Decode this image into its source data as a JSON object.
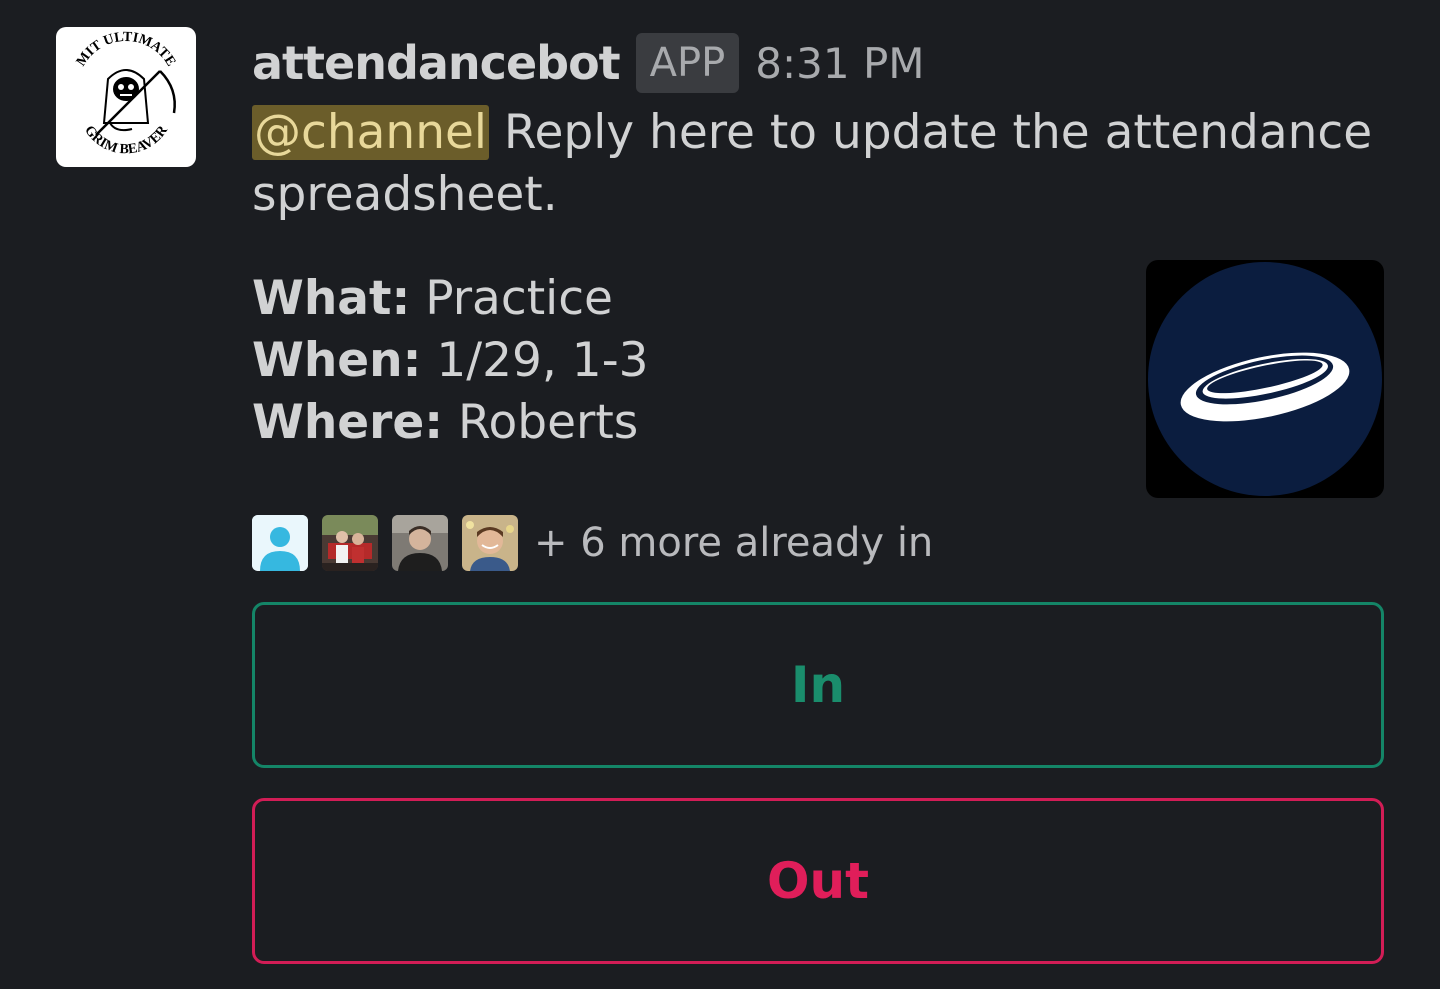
{
  "bot": {
    "name": "attendancebot",
    "badge": "APP",
    "time": "8:31 PM",
    "avatar_text_top": "MIT ULTIMATE",
    "avatar_text_bottom": "GRIM BEAVER"
  },
  "message": {
    "mention": "@channel",
    "text": " Reply here to update the attendance spreadsheet."
  },
  "event": {
    "what_label": "What:",
    "what_value": " Practice",
    "when_label": "When:",
    "when_value": " 1/29, 1-3",
    "where_label": "Where:",
    "where_value": " Roberts",
    "image_icon": "frisbee-icon"
  },
  "attendees": {
    "more_text": "+ 6 more already in"
  },
  "buttons": {
    "in_label": "In",
    "out_label": "Out"
  },
  "colors": {
    "background": "#1b1d21",
    "in_green": "#1a8d6c",
    "out_red": "#e01e5a",
    "mention_bg": "#6b5d2a"
  }
}
